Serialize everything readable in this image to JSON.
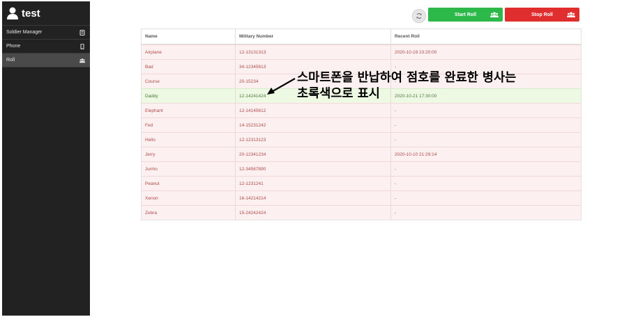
{
  "sidebar": {
    "brand": "test",
    "items": [
      {
        "label": "Soldier Manager",
        "icon": "id-card-icon"
      },
      {
        "label": "Phone",
        "icon": "phone-icon"
      },
      {
        "label": "Roll",
        "icon": "group-icon"
      }
    ],
    "active": "Roll"
  },
  "toolbar": {
    "refresh_icon": "refresh-icon",
    "start_label": "Start Roll",
    "stop_label": "Stop Roll"
  },
  "colors": {
    "sidebar_bg": "#222222",
    "start": "#2db84a",
    "stop": "#e02d2d",
    "row_absent": "#fdf0f0",
    "row_present": "#eef9e4"
  },
  "table": {
    "headers": [
      "Name",
      "Military Number",
      "Recent Roll"
    ],
    "rows": [
      {
        "name": "Airplane",
        "number": "12-13131313",
        "recent": "2020-10-19 23:20:00",
        "status": "absent"
      },
      {
        "name": "Bad",
        "number": "34-12345613",
        "recent": "-",
        "status": "absent"
      },
      {
        "name": "Course",
        "number": "20-15234",
        "recent": "-",
        "status": "absent"
      },
      {
        "name": "Daddy",
        "number": "12-14241424",
        "recent": "2020-10-21 17:30:00",
        "status": "present"
      },
      {
        "name": "Elephant",
        "number": "12-14145612",
        "recent": "-",
        "status": "absent"
      },
      {
        "name": "Fed",
        "number": "14-15231242",
        "recent": "-",
        "status": "absent"
      },
      {
        "name": "Hello",
        "number": "12-12313123",
        "recent": "-",
        "status": "absent"
      },
      {
        "name": "Jerry",
        "number": "20-12341234",
        "recent": "2020-10-10 21:29:14",
        "status": "absent"
      },
      {
        "name": "Junho",
        "number": "12-34567890",
        "recent": "-",
        "status": "absent"
      },
      {
        "name": "Peanut",
        "number": "12-1231241",
        "recent": "-",
        "status": "absent"
      },
      {
        "name": "Xenon",
        "number": "16-14214214",
        "recent": "-",
        "status": "absent"
      },
      {
        "name": "Zebra",
        "number": "15-24242424",
        "recent": "-",
        "status": "absent"
      }
    ]
  },
  "annotation": {
    "line1": "스마트폰을 반납하여 점호를 완료한 병사는",
    "line2": "초록색으로 표시"
  }
}
